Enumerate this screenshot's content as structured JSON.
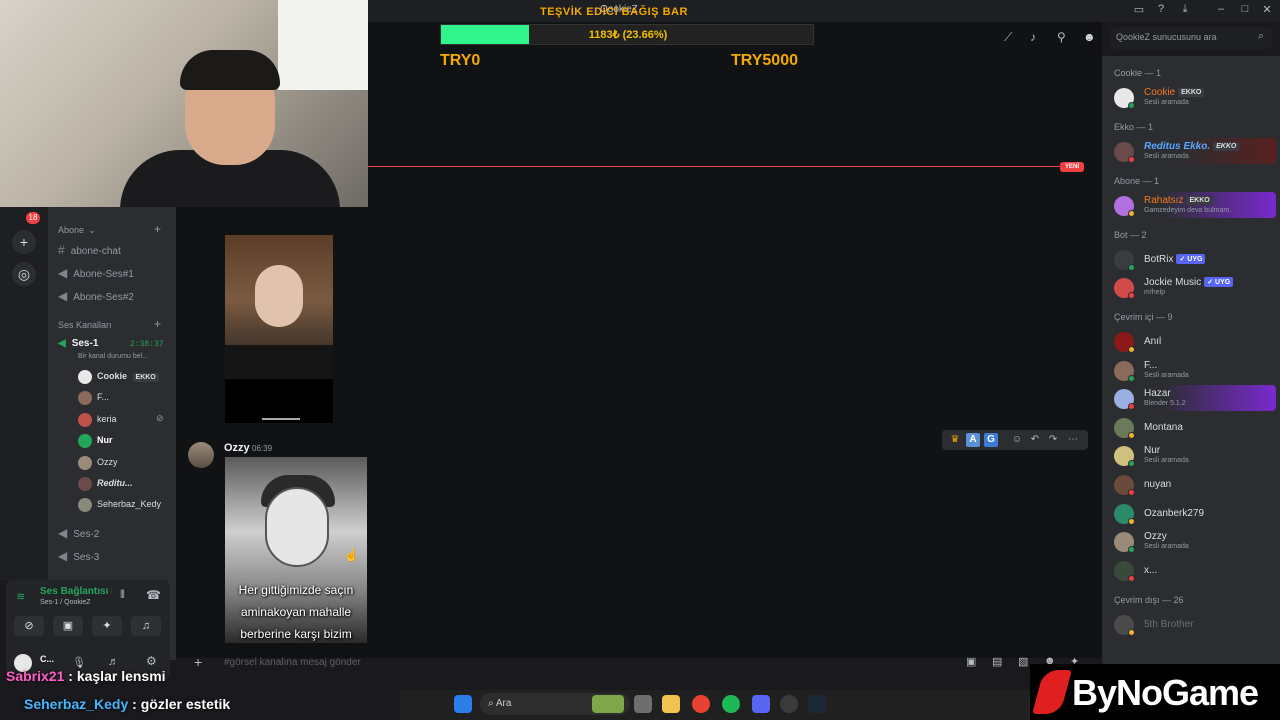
{
  "window": {
    "title": "QookieZ"
  },
  "goal": {
    "title": "TEŞVİK EDİCİ BAĞIŞ BAR",
    "progress_text": "1183₺ (23.66%)",
    "progress_fraction": 0.2366,
    "min_label": "TRY0",
    "max_label": "TRY5000",
    "fill_color": "#2ff58c"
  },
  "server": {
    "notification_count": "18"
  },
  "sidebar": {
    "category_abone": "Abone",
    "channels_abone": [
      "abone-chat",
      "Abone-Ses#1",
      "Abone-Ses#2"
    ],
    "category_voice": "Ses Kanalları",
    "voice_channel": {
      "name": "Ses-1",
      "timer": "2:38:37",
      "status": "Bir kanal durumu bel..."
    },
    "voice_members": [
      "Cookie",
      "F...",
      "keria",
      "Nur",
      "Ozzy",
      "Reditu...",
      "Seherbaz_Kedy"
    ],
    "voice_member_tag": "EKKO",
    "other_voice": [
      "Ses-2",
      "Ses-3"
    ]
  },
  "voice_panel": {
    "status": "Ses Bağlantısı K",
    "channel": "Ses-1 / QookieZ",
    "user": "C..."
  },
  "search": {
    "placeholder": "QookieZ sunucusunu ara"
  },
  "new_pill": "YENİ",
  "message": {
    "author": "Ozzy",
    "time": "06:39",
    "image_caption": "Her gittiğimizde saçın aminakoyan mahalle berberine karşı bizim"
  },
  "input": {
    "placeholder": "#görsel kanalına mesaj gönder"
  },
  "members": {
    "sections": [
      {
        "header": "Cookie — 1",
        "rows": [
          {
            "name": "Cookie",
            "tag": "EKKO",
            "sub": "Sesli aramada",
            "color": "#f47b1f"
          }
        ]
      },
      {
        "header": "Ekko — 1",
        "rows": [
          {
            "name": "Reditus Ekko.",
            "tag": "EKKO",
            "sub": "Sesli aramada",
            "color": "#5aa6ff"
          }
        ]
      },
      {
        "header": "Abone — 1",
        "rows": [
          {
            "name": "Rahatsız",
            "tag": "EKKO",
            "sub": "Gamzedeyim deva bulmam.",
            "color": "#f47b1f"
          }
        ]
      },
      {
        "header": "Bot — 2",
        "rows": [
          {
            "name": "BotRix",
            "tag": "✓ UYG",
            "sub": "",
            "color": "#dbdee1"
          },
          {
            "name": "Jockie Music",
            "tag": "✓ UYG",
            "sub": "m!help",
            "color": "#dbdee1"
          }
        ]
      },
      {
        "header": "Çevrim içi — 9",
        "rows": [
          {
            "name": "Anıl",
            "tag": "",
            "sub": "",
            "color": "#dbdee1"
          },
          {
            "name": "F...",
            "tag": "",
            "sub": "Sesli aramada",
            "color": "#dbdee1"
          },
          {
            "name": "Hazar",
            "tag": "",
            "sub": "Blender 5.1.2",
            "color": "#dbdee1"
          },
          {
            "name": "Montana",
            "tag": "",
            "sub": "",
            "color": "#dbdee1"
          },
          {
            "name": "Nur",
            "tag": "",
            "sub": "Sesli aramada",
            "color": "#dbdee1"
          },
          {
            "name": "nuyan",
            "tag": "",
            "sub": "",
            "color": "#dbdee1"
          },
          {
            "name": "Ozanberk279",
            "tag": "",
            "sub": "",
            "color": "#dbdee1"
          },
          {
            "name": "Ozzy",
            "tag": "",
            "sub": "Sesli aramada",
            "color": "#dbdee1"
          },
          {
            "name": "x...",
            "tag": "",
            "sub": "",
            "color": "#dbdee1"
          }
        ]
      },
      {
        "header": "Çevrim dışı — 26",
        "rows": [
          {
            "name": "5th Brother",
            "tag": "",
            "sub": "",
            "color": "#6d6f78"
          }
        ]
      }
    ]
  },
  "overlay_chat": [
    {
      "user": "Sabrix21",
      "text": " : kaşlar lensmi"
    },
    {
      "user": "Seherbaz_Kedy",
      "text": " : gözler estetik"
    }
  ],
  "taskbar": {
    "search": "Ara"
  },
  "brand": "ByNoGame"
}
